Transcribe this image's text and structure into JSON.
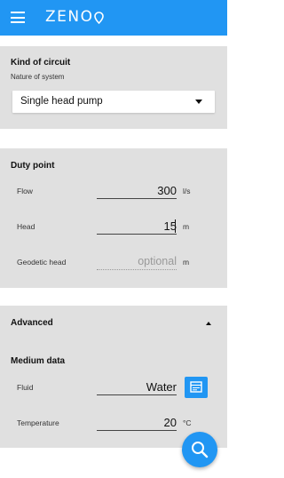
{
  "app": {
    "logo_text": "ZENO",
    "accent_color": "#2196f3",
    "icons": [
      "menu-icon",
      "location-pin-icon",
      "data-table-icon",
      "search-icon"
    ]
  },
  "circuit": {
    "title": "Kind of circuit",
    "subtitle": "Nature of system",
    "selected": "Single head pump"
  },
  "duty_point": {
    "title": "Duty point",
    "rows": [
      {
        "label": "Flow",
        "value": "300",
        "unit": "l/s"
      },
      {
        "label": "Head",
        "value": "15",
        "unit": "m"
      },
      {
        "label": "Geodetic head",
        "placeholder": "optional",
        "unit": "m"
      }
    ]
  },
  "advanced": {
    "title": "Advanced",
    "medium_title": "Medium data",
    "rows": [
      {
        "label": "Fluid",
        "value": "Water"
      },
      {
        "label": "Temperature",
        "value": "20",
        "unit": "°C"
      }
    ]
  }
}
